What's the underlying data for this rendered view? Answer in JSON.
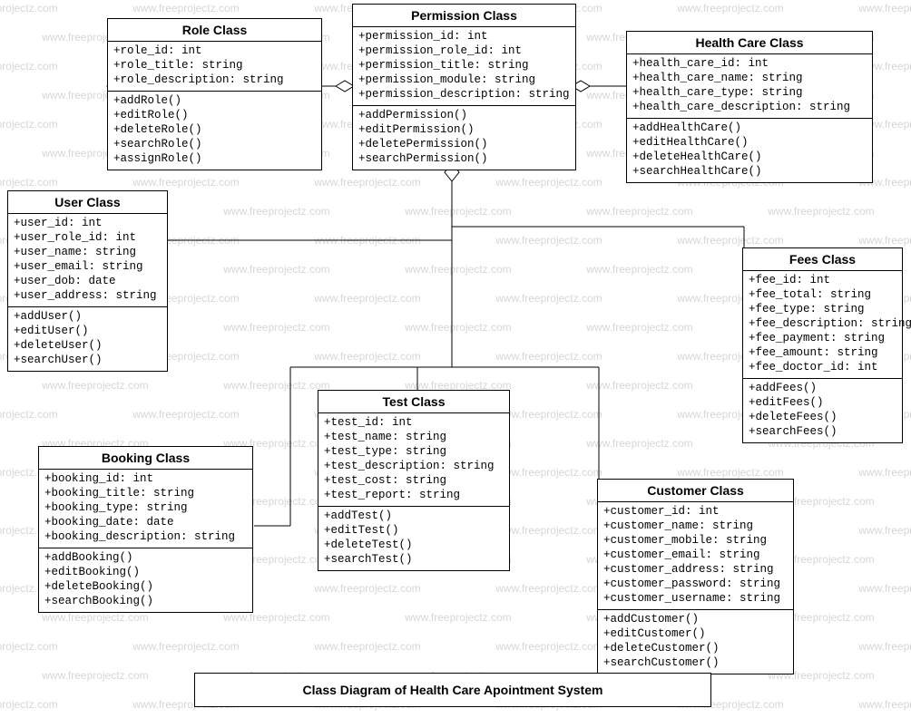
{
  "watermark": "www.freeprojectz.com",
  "caption": "Class Diagram of Health Care Apointment System",
  "classes": {
    "role": {
      "title": "Role Class",
      "attrs": [
        "+role_id: int",
        "+role_title: string",
        "+role_description: string"
      ],
      "ops": [
        "+addRole()",
        "+editRole()",
        "+deleteRole()",
        "+searchRole()",
        "+assignRole()"
      ]
    },
    "permission": {
      "title": "Permission Class",
      "attrs": [
        "+permission_id: int",
        "+permission_role_id: int",
        "+permission_title: string",
        "+permission_module: string",
        "+permission_description: string"
      ],
      "ops": [
        "+addPermission()",
        "+editPermission()",
        "+deletePermission()",
        "+searchPermission()"
      ]
    },
    "healthcare": {
      "title": "Health Care Class",
      "attrs": [
        "+health_care_id: int",
        "+health_care_name: string",
        "+health_care_type: string",
        "+health_care_description: string"
      ],
      "ops": [
        "+addHealthCare()",
        "+editHealthCare()",
        "+deleteHealthCare()",
        "+searchHealthCare()"
      ]
    },
    "user": {
      "title": "User Class",
      "attrs": [
        "+user_id: int",
        "+user_role_id: int",
        "+user_name: string",
        "+user_email: string",
        "+user_dob: date",
        "+user_address: string"
      ],
      "ops": [
        "+addUser()",
        "+editUser()",
        "+deleteUser()",
        "+searchUser()"
      ]
    },
    "fees": {
      "title": "Fees Class",
      "attrs": [
        "+fee_id: int",
        "+fee_total: string",
        "+fee_type: string",
        "+fee_description: string",
        "+fee_payment: string",
        "+fee_amount: string",
        "+fee_doctor_id: int"
      ],
      "ops": [
        "+addFees()",
        "+editFees()",
        "+deleteFees()",
        "+searchFees()"
      ]
    },
    "test": {
      "title": "Test Class",
      "attrs": [
        "+test_id: int",
        "+test_name: string",
        "+test_type: string",
        "+test_description: string",
        "+test_cost: string",
        "+test_report: string"
      ],
      "ops": [
        "+addTest()",
        "+editTest()",
        "+deleteTest()",
        "+searchTest()"
      ]
    },
    "booking": {
      "title": "Booking Class",
      "attrs": [
        "+booking_id: int",
        "+booking_title: string",
        "+booking_type: string",
        "+booking_date: date",
        "+booking_description: string"
      ],
      "ops": [
        "+addBooking()",
        "+editBooking()",
        "+deleteBooking()",
        "+searchBooking()"
      ]
    },
    "customer": {
      "title": "Customer Class",
      "attrs": [
        "+customer_id: int",
        "+customer_name: string",
        "+customer_mobile: string",
        "+customer_email: string",
        "+customer_address: string",
        "+customer_password: string",
        "+customer_username: string"
      ],
      "ops": [
        "+addCustomer()",
        "+editCustomer()",
        "+deleteCustomer()",
        "+searchCustomer()"
      ]
    }
  }
}
